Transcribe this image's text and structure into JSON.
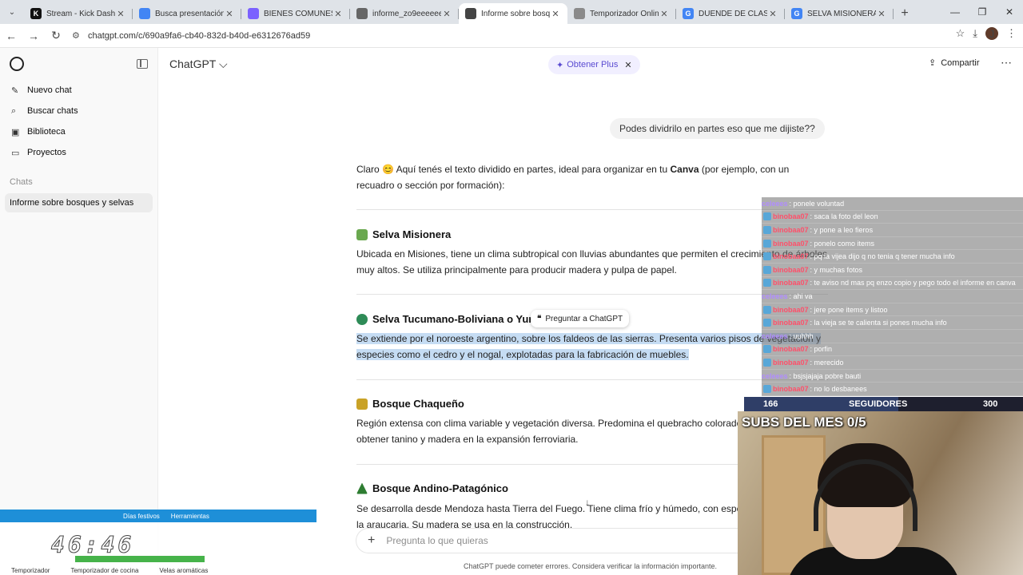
{
  "browser": {
    "tabs": [
      {
        "title": "Stream - Kick Dashb",
        "fav_color": "#111111",
        "fav_glyph": "K",
        "active": false
      },
      {
        "title": "Busca presentación",
        "fav_color": "#4285f4",
        "fav_glyph": "",
        "active": false
      },
      {
        "title": "BIENES COMUNES",
        "fav_color": "#7b61ff",
        "fav_glyph": "",
        "active": false
      },
      {
        "title": "informe_zo9eeeeee",
        "fav_color": "#666666",
        "fav_glyph": "",
        "active": false
      },
      {
        "title": "Informe sobre bosq",
        "fav_color": "#444444",
        "fav_glyph": "",
        "active": true
      },
      {
        "title": "Temporizador Onlin",
        "fav_color": "#8a8a8a",
        "fav_glyph": "",
        "active": false
      },
      {
        "title": "DUENDE DE CLASH",
        "fav_color": "#4285f4",
        "fav_glyph": "G",
        "active": false
      },
      {
        "title": "SELVA MISIONERA",
        "fav_color": "#4285f4",
        "fav_glyph": "G",
        "active": false
      }
    ],
    "url": "chatgpt.com/c/690a9fa6-cb40-832d-b40d-e6312676ad59",
    "profile_initial": "J"
  },
  "sidebar": {
    "items": [
      {
        "label": "Nuevo chat",
        "icon": "✎"
      },
      {
        "label": "Buscar chats",
        "icon": "⌕"
      },
      {
        "label": "Biblioteca",
        "icon": "▣"
      },
      {
        "label": "Proyectos",
        "icon": "▭"
      }
    ],
    "section_label": "Chats",
    "chats": [
      "Informe sobre bosques y selvas"
    ]
  },
  "header": {
    "model": "ChatGPT ⌵",
    "plus_label": "Obtener Plus",
    "share_label": "Compartir"
  },
  "conversation": {
    "user_message": "Podes dividrilo en partes eso que me dijiste??",
    "intro_pre": "Claro 😊 Aquí tenés el texto dividido en partes, ideal para organizar en tu ",
    "intro_bold": "Canva",
    "intro_post": " (por ejemplo, con un recuadro o sección por formación):",
    "sections": [
      {
        "title": "Selva Misionera",
        "emoji_color": "#6aa84f",
        "text": "Ubicada en Misiones, tiene un clima subtropical con lluvias abundantes que permiten el crecimiento de árboles muy altos. Se utiliza principalmente para producir madera y pulpa de papel."
      },
      {
        "title": "Selva Tucumano-Boliviana o Yur",
        "emoji_color": "#2e8b57",
        "text": "Se extiende por el noroeste argentino, sobre los faldeos de las sierras. Presenta varios pisos de vegetación y especies como el cedro y el nogal, explotadas para la fabricación de muebles."
      },
      {
        "title": "Bosque Chaqueño",
        "emoji_color": "#c9a227",
        "text": "Región extensa con clima variable y vegetación diversa. Predomina el quebracho colorado, usado para obtener tanino y madera en la expansión ferroviaria."
      },
      {
        "title": "Bosque Andino-Patagónico",
        "emoji_color": "#2e7d32",
        "text": "Se desarrolla desde Mendoza hasta Tierra del Fuego. Tiene clima frío y húmedo, con especies como el ñire y la araucaria. Su madera se usa en la construcción."
      }
    ],
    "ask_popup": "Preguntar a ChatGPT",
    "composer_placeholder": "Pregunta lo que quieras",
    "disclaimer": "ChatGPT puede cometer errores. Considera verificar la información importante."
  },
  "stream": {
    "chat": [
      {
        "user": "celeees",
        "alt": true,
        "msg": ": ponele voluntad"
      },
      {
        "user": "binobaa07",
        "alt": false,
        "msg": ": saca la foto del leon"
      },
      {
        "user": "binobaa07",
        "alt": false,
        "msg": ": y pone a leo fieros"
      },
      {
        "user": "binobaa07",
        "alt": false,
        "msg": ": ponelo como items"
      },
      {
        "user": "binobaa07",
        "alt": false,
        "msg": ": pq la vijea dijo q no tenia q tener mucha info"
      },
      {
        "user": "binobaa07",
        "alt": false,
        "msg": ": y muchas fotos"
      },
      {
        "user": "binobaa07",
        "alt": false,
        "msg": ": te aviso nd mas pq enzo copio y pego todo el informe en canva"
      },
      {
        "user": "celeees",
        "alt": true,
        "msg": ": ahi va"
      },
      {
        "user": "binobaa07",
        "alt": false,
        "msg": ": jere pone items y listoo"
      },
      {
        "user": "binobaa07",
        "alt": false,
        "msg": ": la vieja se te calienta si pones mucha info"
      },
      {
        "user": "celeees",
        "alt": true,
        "msg": ": uuhhh"
      },
      {
        "user": "binobaa07",
        "alt": false,
        "msg": ": porfin"
      },
      {
        "user": "binobaa07",
        "alt": false,
        "msg": ": merecido"
      },
      {
        "user": "celeees",
        "alt": true,
        "msg": ": bsjsjajaja pobre bauti"
      },
      {
        "user": "binobaa07",
        "alt": false,
        "msg": ": no lo desbanees"
      }
    ],
    "followers_current": "166",
    "followers_label": "SEGUIDORES",
    "followers_goal": "300",
    "followers_progress": 0.553,
    "subs_label": "SUBS DEL MES 0/5"
  },
  "timer": {
    "strip_items": [
      "Días festivos",
      "Herramientas"
    ],
    "digits": "46:46",
    "links": [
      "Temporizador",
      "Temporizador de cocina",
      "Velas aromáticas"
    ]
  }
}
